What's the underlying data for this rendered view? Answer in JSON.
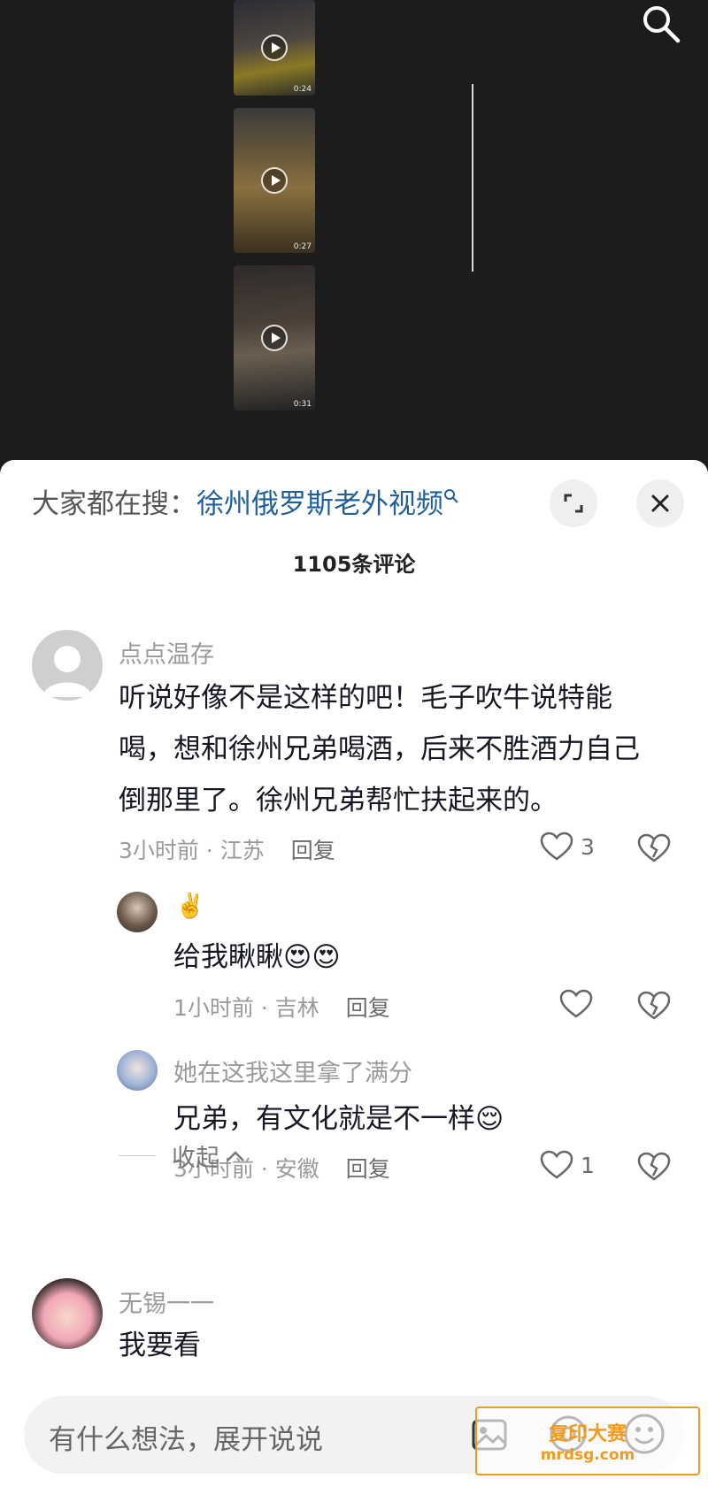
{
  "video_list": {
    "durations": [
      "0:24",
      "0:27",
      "0:31"
    ]
  },
  "sheet": {
    "search_label": "大家都在搜：",
    "search_term": "徐州俄罗斯老外视频",
    "comment_count": "1105条评论"
  },
  "comments": [
    {
      "user": "点点温存",
      "text": "听说好像不是这样的吧！毛子吹牛说特能喝，想和徐州兄弟喝酒，后来不胜酒力自己倒那里了。徐州兄弟帮忙扶起来的。",
      "meta": "3小时前 · 江苏",
      "reply": "回复",
      "likes": "3",
      "replies": [
        {
          "user": "✌️",
          "text": "给我瞅瞅😍😍",
          "meta": "1小时前 · 吉林",
          "reply": "回复",
          "likes": ""
        },
        {
          "user": "她在这我这里拿了满分",
          "text": "兄弟，有文化就是不一样😌",
          "meta": "3小时前 · 安徽",
          "reply": "回复",
          "likes": "1"
        }
      ],
      "collapse": "收起"
    },
    {
      "user": "无锡一一",
      "text": "我要看"
    }
  ],
  "input": {
    "placeholder": "有什么想法，展开说说"
  },
  "watermark": {
    "title": "复印大赛",
    "url": "mrdsg.com"
  },
  "colors": {
    "accent_link": "#1f5f9c",
    "watermark": "#f29a1f"
  }
}
